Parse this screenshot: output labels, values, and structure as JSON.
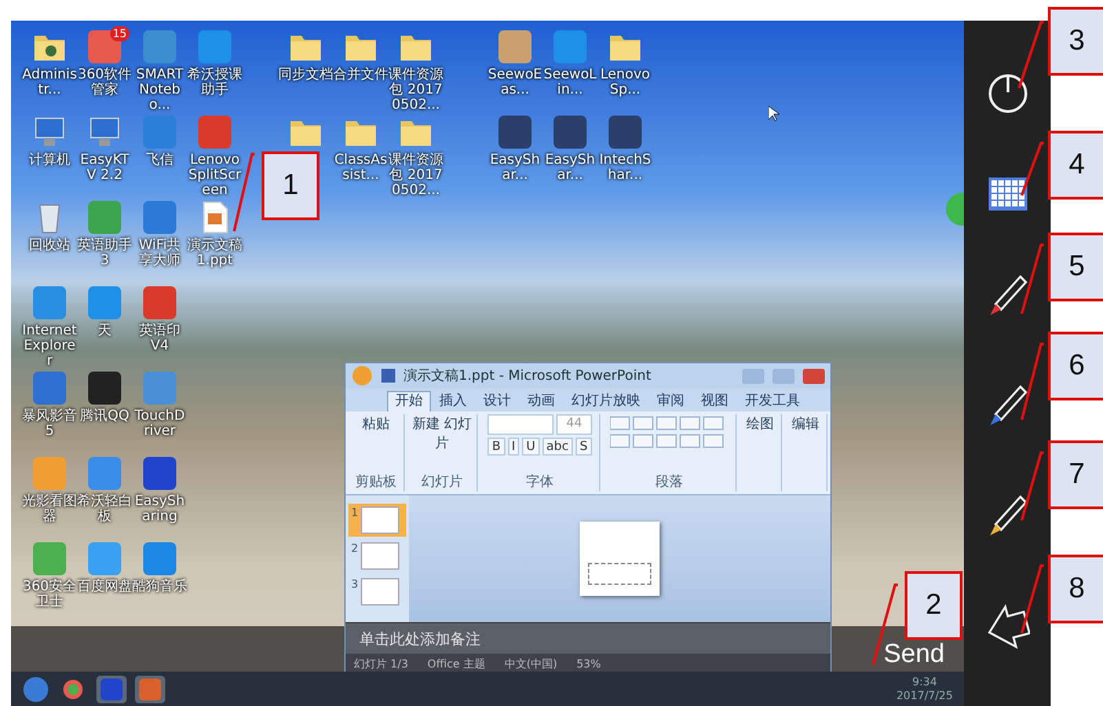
{
  "desktop": {
    "left_icon_rows": [
      [
        {
          "label": "Administr...",
          "kind": "user-folder"
        },
        {
          "label": "360软件管家",
          "kind": "tile",
          "color": "#e85a4f",
          "badge": "15"
        },
        {
          "label": "SMART Notebo...",
          "kind": "tile",
          "color": "#3a8ed0"
        },
        {
          "label": "希沃授课助手",
          "kind": "tile",
          "color": "#1e90e8"
        }
      ],
      [
        {
          "label": "计算机",
          "kind": "monitor"
        },
        {
          "label": "EasyKTV 2.2",
          "kind": "monitor"
        },
        {
          "label": "飞信",
          "kind": "tile",
          "color": "#2b7fd4"
        },
        {
          "label": "Lenovo SplitScreen",
          "kind": "tile",
          "color": "#d83b2a"
        }
      ],
      [
        {
          "label": "回收站",
          "kind": "bin"
        },
        {
          "label": "英语助手 3",
          "kind": "tile",
          "color": "#3aa54a"
        },
        {
          "label": "WiFi共享大师",
          "kind": "tile",
          "color": "#2a7ad8"
        },
        {
          "label": "演示文稿1.ppt",
          "kind": "document"
        }
      ],
      [
        {
          "label": "Internet Explorer",
          "kind": "tile",
          "color": "#2a8ee0"
        },
        {
          "label": "天",
          "kind": "tile",
          "color": "#1e90e8"
        },
        {
          "label": "英语印 V4",
          "kind": "tile",
          "color": "#d83b2a"
        }
      ],
      [
        {
          "label": "暴风影音5",
          "kind": "tile",
          "color": "#2e6fcf"
        },
        {
          "label": "腾讯QQ",
          "kind": "tile",
          "color": "#222222"
        },
        {
          "label": "TouchDriver",
          "kind": "tile",
          "color": "#4a90d9"
        }
      ],
      [
        {
          "label": "光影看图器",
          "kind": "tile",
          "color": "#f0a030"
        },
        {
          "label": "希沃轻白板",
          "kind": "tile",
          "color": "#3a8ee8"
        },
        {
          "label": "EasySharing",
          "kind": "tile",
          "color": "#2244cc"
        }
      ],
      [
        {
          "label": "360安全卫士",
          "kind": "tile",
          "color": "#4caf50"
        },
        {
          "label": "百度网盘",
          "kind": "tile",
          "color": "#3aa0f0"
        },
        {
          "label": "酷狗音乐",
          "kind": "tile",
          "color": "#1e88e5"
        }
      ]
    ],
    "middle_icons": [
      {
        "label": "同步文档",
        "kind": "folder"
      },
      {
        "label": "合并文件",
        "kind": "folder"
      },
      {
        "label": "课件资源包 20170502...",
        "kind": "folder"
      },
      {
        "kind": "folder"
      },
      {
        "label": "ClassAssist...",
        "kind": "folder"
      },
      {
        "label": "课件资源包 20170502...",
        "kind": "folder"
      }
    ],
    "right_icons": [
      {
        "label": "SeewoEas...",
        "kind": "tile",
        "color": "#c9a070"
      },
      {
        "label": "SeewoLin...",
        "kind": "tile",
        "color": "#1e90e8"
      },
      {
        "label": "LenovoSp...",
        "kind": "folder"
      },
      {
        "label": "EasyShar...",
        "kind": "tile",
        "color": "#2a3f6a"
      },
      {
        "label": "EasyShar...",
        "kind": "tile",
        "color": "#2a3f6a"
      },
      {
        "label": "IntechShar...",
        "kind": "tile",
        "color": "#2a3f6a"
      }
    ]
  },
  "powerpoint": {
    "title": "演示文稿1.ppt - Microsoft PowerPoint",
    "tabs": [
      {
        "label": "开始",
        "selected": true
      },
      {
        "label": "插入",
        "selected": false
      },
      {
        "label": "设计",
        "selected": false
      },
      {
        "label": "动画",
        "selected": false
      },
      {
        "label": "幻灯片放映",
        "selected": false
      },
      {
        "label": "审阅",
        "selected": false
      },
      {
        "label": "视图",
        "selected": false
      },
      {
        "label": "开发工具",
        "selected": false
      }
    ],
    "paste": "粘贴",
    "new_slide": "新建 幻灯片",
    "font_size": "44",
    "font_buttons": [
      "B",
      "I",
      "U",
      "abc",
      "S"
    ],
    "draw": "绘图",
    "edit": "编辑",
    "groups": [
      "剪贴板",
      "幻灯片",
      "字体",
      "段落"
    ],
    "thumbnails": [
      {
        "number": "1",
        "selected": true
      },
      {
        "number": "2",
        "selected": false
      },
      {
        "number": "3",
        "selected": false
      }
    ],
    "notes_placeholder": "单击此处添加备注",
    "status": [
      "幻灯片 1/3",
      "Office 主题",
      "中文(中国)",
      "53%"
    ]
  },
  "send_label": "Send",
  "taskbar": {
    "time": "9:34",
    "date": "2017/7/25"
  },
  "side_buttons": [
    {
      "kind": "power"
    },
    {
      "kind": "keyboard"
    },
    {
      "kind": "pen",
      "color": "#e03030"
    },
    {
      "kind": "pen",
      "color": "#3a6fe0"
    },
    {
      "kind": "pen",
      "color": "#e8b030"
    },
    {
      "kind": "back"
    }
  ],
  "callouts": [
    {
      "number": "1"
    },
    {
      "number": "2"
    },
    {
      "number": "3"
    },
    {
      "number": "4"
    },
    {
      "number": "5"
    },
    {
      "number": "6"
    },
    {
      "number": "7"
    },
    {
      "number": "8"
    }
  ]
}
